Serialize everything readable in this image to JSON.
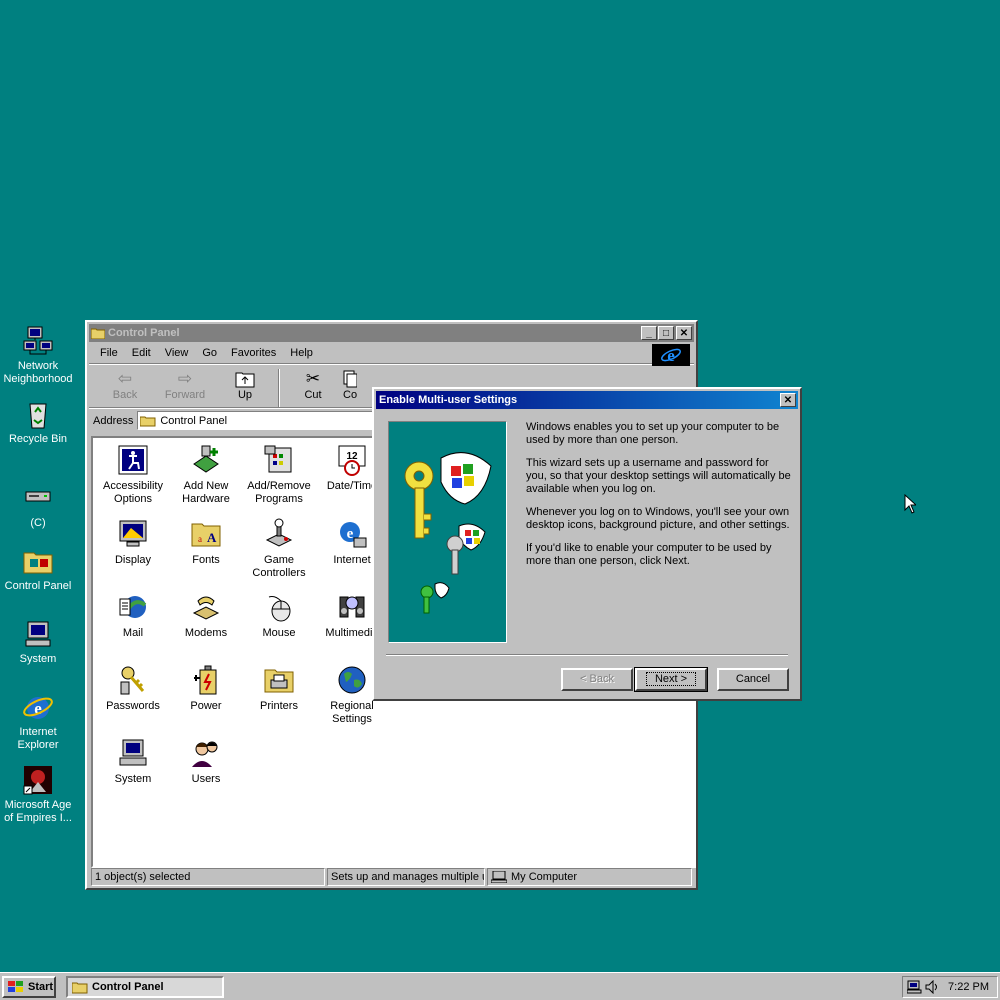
{
  "desktop_icons": [
    {
      "label": "Network Neighborhood",
      "icon": "network-neighborhood-icon"
    },
    {
      "label": "Recycle Bin",
      "icon": "recycle-bin-icon"
    },
    {
      "label": "(C)",
      "icon": "drive-icon"
    },
    {
      "label": "Control Panel",
      "icon": "control-panel-icon"
    },
    {
      "label": "System",
      "icon": "system-icon"
    },
    {
      "label": "Internet Explorer",
      "icon": "internet-explorer-icon"
    },
    {
      "label": "Microsoft Age of Empires I...",
      "icon": "age-of-empires-icon"
    }
  ],
  "cp_window": {
    "title": "Control Panel",
    "menu": [
      "File",
      "Edit",
      "View",
      "Go",
      "Favorites",
      "Help"
    ],
    "toolbar": {
      "back": "Back",
      "forward": "Forward",
      "up": "Up",
      "cut": "Cut",
      "copy": "Co"
    },
    "address_label": "Address",
    "address_value": "Control Panel",
    "items": [
      {
        "label": "Accessibility Options",
        "icon": "accessibility-icon"
      },
      {
        "label": "Add New Hardware",
        "icon": "add-hardware-icon"
      },
      {
        "label": "Add/Remove Programs",
        "icon": "add-remove-programs-icon"
      },
      {
        "label": "Date/Time",
        "icon": "date-time-icon"
      },
      {
        "label": "Display",
        "icon": "display-icon"
      },
      {
        "label": "Fonts",
        "icon": "fonts-icon"
      },
      {
        "label": "Game Controllers",
        "icon": "game-controllers-icon"
      },
      {
        "label": "Internet",
        "icon": "internet-icon"
      },
      {
        "label": "Mail",
        "icon": "mail-icon"
      },
      {
        "label": "Modems",
        "icon": "modems-icon"
      },
      {
        "label": "Mouse",
        "icon": "mouse-icon"
      },
      {
        "label": "Multimedia",
        "icon": "multimedia-icon"
      },
      {
        "label": "Passwords",
        "icon": "passwords-icon"
      },
      {
        "label": "Power",
        "icon": "power-icon"
      },
      {
        "label": "Printers",
        "icon": "printers-icon"
      },
      {
        "label": "Regional Settings",
        "icon": "regional-settings-icon"
      },
      {
        "label": "System",
        "icon": "system-icon"
      },
      {
        "label": "Users",
        "icon": "users-icon"
      }
    ],
    "status": {
      "selected": "1 object(s) selected",
      "description": "Sets up and manages multiple us",
      "zone": "My Computer"
    }
  },
  "dialog": {
    "title": "Enable Multi-user Settings",
    "paragraphs": [
      "Windows enables you to set up your computer to be used by more than one person.",
      "This wizard sets up a username and password for you, so that your desktop settings will automatically be available when you log on.",
      "Whenever you log on to Windows, you'll see your own desktop icons, background picture, and other settings.",
      "If you'd like to enable your computer to be used by more than one person, click Next."
    ],
    "back_label": "< Back",
    "next_label": "Next >",
    "cancel_label": "Cancel"
  },
  "taskbar": {
    "start_label": "Start",
    "task_label": "Control Panel",
    "clock": "7:22 PM"
  },
  "colors": {
    "desktop": "#008080",
    "title_active": "#000080",
    "title_inactive": "#808080",
    "face": "#c0c0c0"
  }
}
